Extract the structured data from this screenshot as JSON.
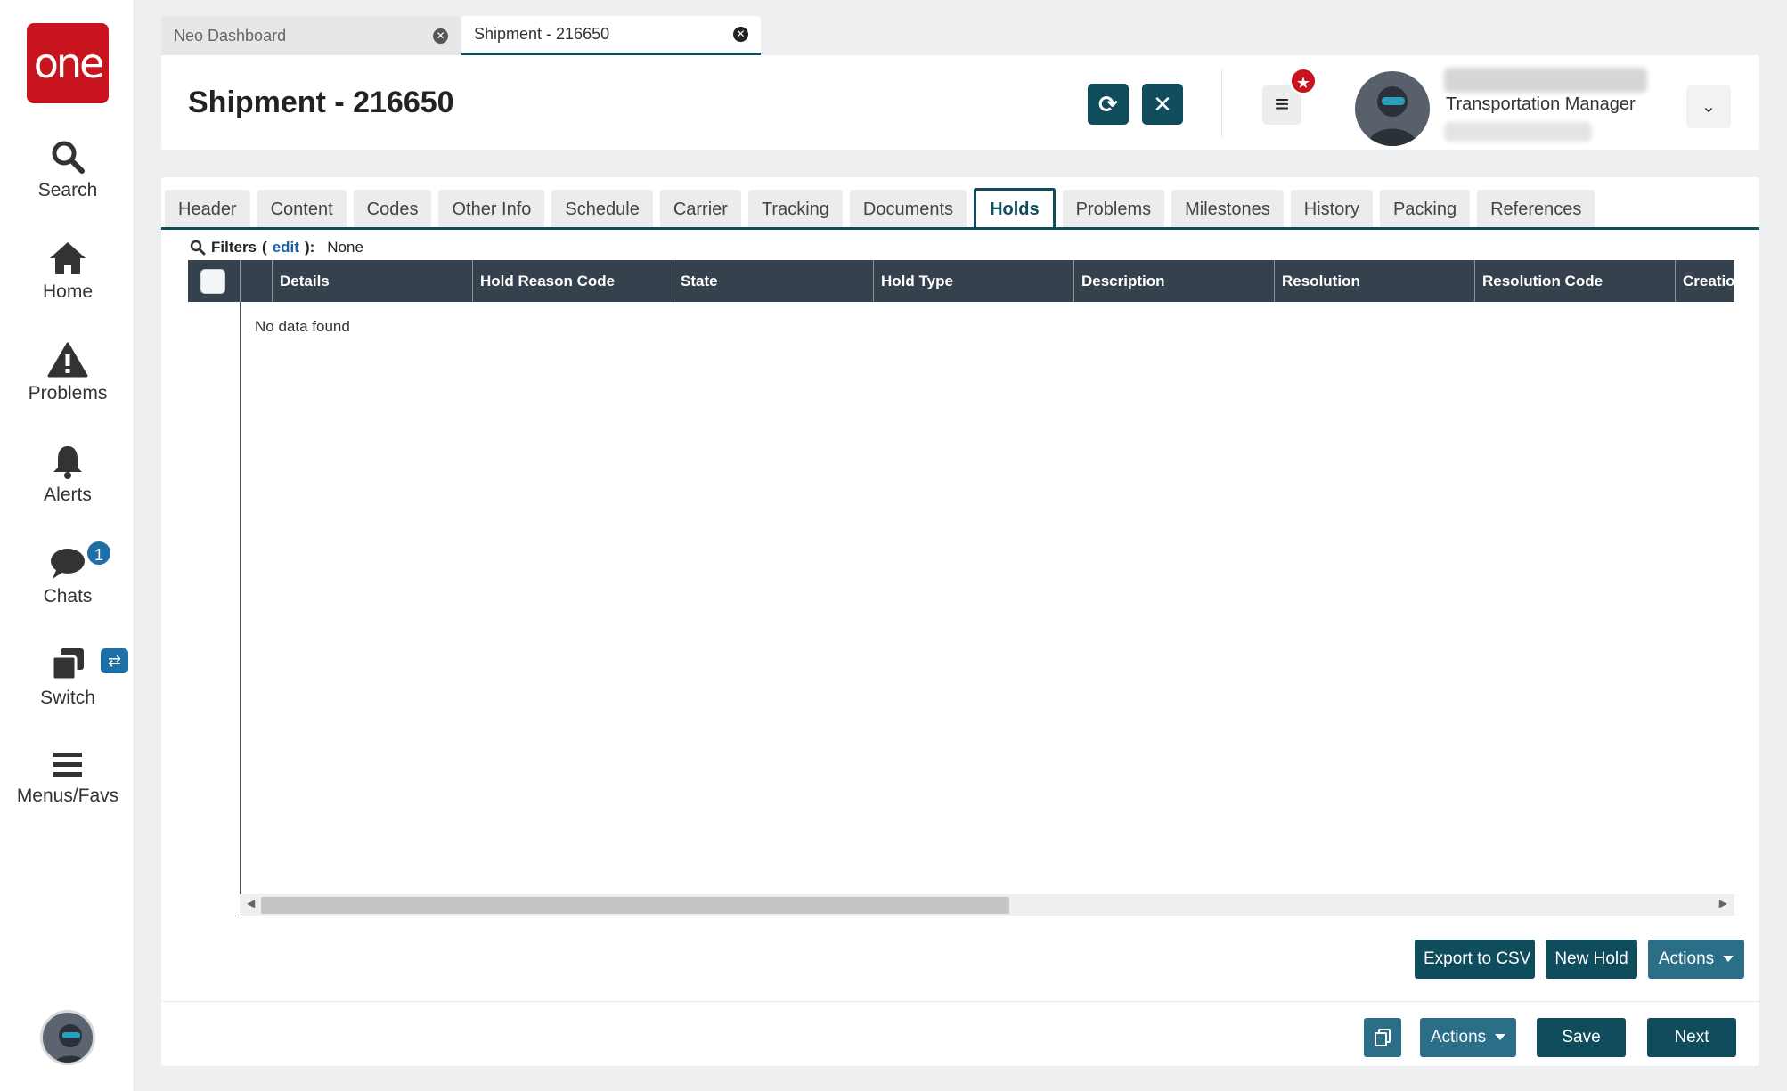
{
  "sidebar": {
    "logo_text": "one",
    "items": [
      {
        "label": "Search",
        "icon": "search-icon"
      },
      {
        "label": "Home",
        "icon": "home-icon"
      },
      {
        "label": "Problems",
        "icon": "warning-icon"
      },
      {
        "label": "Alerts",
        "icon": "bell-icon"
      },
      {
        "label": "Chats",
        "icon": "chat-icon",
        "badge": "1"
      },
      {
        "label": "Switch",
        "icon": "switch-icon",
        "badge": "⇄"
      },
      {
        "label": "Menus/Favs",
        "icon": "hamburger-icon"
      }
    ]
  },
  "doc_tabs": [
    {
      "label": "Neo Dashboard",
      "active": false
    },
    {
      "label": "Shipment - 216650",
      "active": true
    }
  ],
  "header": {
    "title": "Shipment - 216650",
    "refresh_icon": "⟳",
    "close_icon": "✕",
    "menu_icon": "≡",
    "fav_badge": "★",
    "user_role": "Transportation Manager",
    "dropdown_icon": "⌄"
  },
  "tabs": [
    "Header",
    "Content",
    "Codes",
    "Other Info",
    "Schedule",
    "Carrier",
    "Tracking",
    "Documents",
    "Holds",
    "Problems",
    "Milestones",
    "History",
    "Packing",
    "References"
  ],
  "active_tab": "Holds",
  "filters": {
    "label": "Filters",
    "edit": "edit",
    "value": "None"
  },
  "grid": {
    "columns": [
      "Details",
      "Hold Reason Code",
      "State",
      "Hold Type",
      "Description",
      "Resolution",
      "Resolution Code",
      "Creation"
    ],
    "empty_text": "No data found"
  },
  "grid_buttons": {
    "export": "Export to CSV",
    "new_hold": "New Hold",
    "actions": "Actions"
  },
  "footer_buttons": {
    "actions": "Actions",
    "save": "Save",
    "next": "Next"
  },
  "colors": {
    "brand": "#c8141e",
    "accent": "#0f4c5c",
    "badge": "#1d6fa5",
    "header": "#35414c"
  }
}
